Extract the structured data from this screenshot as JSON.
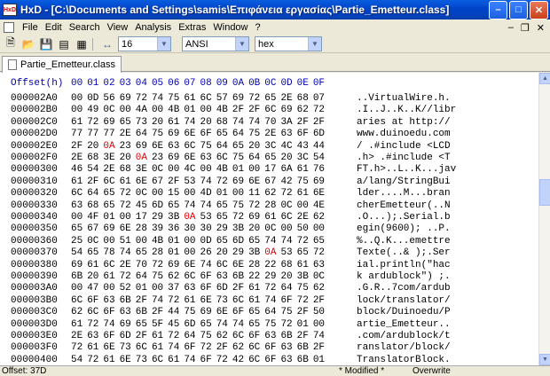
{
  "window": {
    "title": "HxD - [C:\\Documents and Settings\\samis\\Επιφάνεια εργασίας\\Partie_Emetteur.class]",
    "app_icon_text": "HxD"
  },
  "menu": [
    "File",
    "Edit",
    "Search",
    "View",
    "Analysis",
    "Extras",
    "Window",
    "?"
  ],
  "toolbar": {
    "bytes_per_row": "16",
    "charset": "ANSI",
    "offset_base": "hex"
  },
  "tab": {
    "label": "Partie_Emetteur.class"
  },
  "editor": {
    "offset_header": "Offset(h)",
    "column_headers": [
      "00",
      "01",
      "02",
      "03",
      "04",
      "05",
      "06",
      "07",
      "08",
      "09",
      "0A",
      "0B",
      "0C",
      "0D",
      "0E",
      "0F"
    ],
    "rows": [
      {
        "offset": "000002A0",
        "hex": [
          "00",
          "0D",
          "56",
          "69",
          "72",
          "74",
          "75",
          "61",
          "6C",
          "57",
          "69",
          "72",
          "65",
          "2E",
          "68",
          "07"
        ],
        "ascii": "..VirtualWire.h."
      },
      {
        "offset": "000002B0",
        "hex": [
          "00",
          "49",
          "0C",
          "00",
          "4A",
          "00",
          "4B",
          "01",
          "00",
          "4B",
          "2F",
          "2F",
          "6C",
          "69",
          "62",
          "72"
        ],
        "ascii": ".I..J..K..K//libr"
      },
      {
        "offset": "000002C0",
        "hex": [
          "61",
          "72",
          "69",
          "65",
          "73",
          "20",
          "61",
          "74",
          "20",
          "68",
          "74",
          "74",
          "70",
          "3A",
          "2F",
          "2F"
        ],
        "ascii": "aries at http://"
      },
      {
        "offset": "000002D0",
        "hex": [
          "77",
          "77",
          "77",
          "2E",
          "64",
          "75",
          "69",
          "6E",
          "6F",
          "65",
          "64",
          "75",
          "2E",
          "63",
          "6F",
          "6D"
        ],
        "ascii": "www.duinoedu.com"
      },
      {
        "offset": "000002E0",
        "hex": [
          "2F",
          "20",
          "0A",
          "23",
          "69",
          "6E",
          "63",
          "6C",
          "75",
          "64",
          "65",
          "20",
          "3C",
          "4C",
          "43",
          "44"
        ],
        "ascii": "/ .#include <LCD"
      },
      {
        "offset": "000002F0",
        "hex": [
          "2E",
          "68",
          "3E",
          "20",
          "0A",
          "23",
          "69",
          "6E",
          "63",
          "6C",
          "75",
          "64",
          "65",
          "20",
          "3C",
          "54"
        ],
        "ascii": ".h> .#include <T"
      },
      {
        "offset": "00000300",
        "hex": [
          "46",
          "54",
          "2E",
          "68",
          "3E",
          "0C",
          "00",
          "4C",
          "00",
          "4B",
          "01",
          "00",
          "17",
          "6A",
          "61",
          "76"
        ],
        "ascii": "FT.h>..L..K...jav"
      },
      {
        "offset": "00000310",
        "hex": [
          "61",
          "2F",
          "6C",
          "61",
          "6E",
          "67",
          "2F",
          "53",
          "74",
          "72",
          "69",
          "6E",
          "67",
          "42",
          "75",
          "69"
        ],
        "ascii": "a/lang/StringBui"
      },
      {
        "offset": "00000320",
        "hex": [
          "6C",
          "64",
          "65",
          "72",
          "0C",
          "00",
          "15",
          "00",
          "4D",
          "01",
          "00",
          "11",
          "62",
          "72",
          "61",
          "6E"
        ],
        "ascii": "lder....M...bran"
      },
      {
        "offset": "00000330",
        "hex": [
          "63",
          "68",
          "65",
          "72",
          "45",
          "6D",
          "65",
          "74",
          "74",
          "65",
          "75",
          "72",
          "28",
          "0C",
          "00",
          "4E"
        ],
        "ascii": "cherEmetteur(..N"
      },
      {
        "offset": "00000340",
        "hex": [
          "00",
          "4F",
          "01",
          "00",
          "17",
          "29",
          "3B",
          "0A",
          "53",
          "65",
          "72",
          "69",
          "61",
          "6C",
          "2E",
          "62"
        ],
        "ascii": ".O...);.Serial.b"
      },
      {
        "offset": "00000350",
        "hex": [
          "65",
          "67",
          "69",
          "6E",
          "28",
          "39",
          "36",
          "30",
          "30",
          "29",
          "3B",
          "20",
          "0C",
          "00",
          "50",
          "00"
        ],
        "ascii": "egin(9600); ..P."
      },
      {
        "offset": "00000360",
        "hex": [
          "25",
          "0C",
          "00",
          "51",
          "00",
          "4B",
          "01",
          "00",
          "0D",
          "65",
          "6D",
          "65",
          "74",
          "74",
          "72",
          "65"
        ],
        "ascii": "%..Q.K...emettre"
      },
      {
        "offset": "00000370",
        "hex": [
          "54",
          "65",
          "78",
          "74",
          "65",
          "28",
          "01",
          "00",
          "26",
          "20",
          "29",
          "3B",
          "0A",
          "53",
          "65",
          "72"
        ],
        "ascii": "Texte(..& );.Ser"
      },
      {
        "offset": "00000380",
        "hex": [
          "69",
          "61",
          "6C",
          "2E",
          "70",
          "72",
          "69",
          "6E",
          "74",
          "6C",
          "6E",
          "28",
          "22",
          "68",
          "61",
          "63"
        ],
        "ascii": "ial.println(\"hac"
      },
      {
        "offset": "00000390",
        "hex": [
          "6B",
          "20",
          "61",
          "72",
          "64",
          "75",
          "62",
          "6C",
          "6F",
          "63",
          "6B",
          "22",
          "29",
          "20",
          "3B",
          "0C"
        ],
        "ascii": "k ardublock\") ;."
      },
      {
        "offset": "000003A0",
        "hex": [
          "00",
          "47",
          "00",
          "52",
          "01",
          "00",
          "37",
          "63",
          "6F",
          "6D",
          "2F",
          "61",
          "72",
          "64",
          "75",
          "62"
        ],
        "ascii": ".G.R..7com/ardub"
      },
      {
        "offset": "000003B0",
        "hex": [
          "6C",
          "6F",
          "63",
          "6B",
          "2F",
          "74",
          "72",
          "61",
          "6E",
          "73",
          "6C",
          "61",
          "74",
          "6F",
          "72",
          "2F"
        ],
        "ascii": "lock/translator/"
      },
      {
        "offset": "000003C0",
        "hex": [
          "62",
          "6C",
          "6F",
          "63",
          "6B",
          "2F",
          "44",
          "75",
          "69",
          "6E",
          "6F",
          "65",
          "64",
          "75",
          "2F",
          "50"
        ],
        "ascii": "block/Duinoedu/P"
      },
      {
        "offset": "000003D0",
        "hex": [
          "61",
          "72",
          "74",
          "69",
          "65",
          "5F",
          "45",
          "6D",
          "65",
          "74",
          "74",
          "65",
          "75",
          "72",
          "01",
          "00"
        ],
        "ascii": "artie_Emetteur.."
      },
      {
        "offset": "000003E0",
        "hex": [
          "2E",
          "63",
          "6F",
          "6D",
          "2F",
          "61",
          "72",
          "64",
          "75",
          "62",
          "6C",
          "6F",
          "63",
          "6B",
          "2F",
          "74"
        ],
        "ascii": ".com/ardublock/t"
      },
      {
        "offset": "000003F0",
        "hex": [
          "72",
          "61",
          "6E",
          "73",
          "6C",
          "61",
          "74",
          "6F",
          "72",
          "2F",
          "62",
          "6C",
          "6F",
          "63",
          "6B",
          "2F"
        ],
        "ascii": "ranslator/block/"
      },
      {
        "offset": "00000400",
        "hex": [
          "54",
          "72",
          "61",
          "6E",
          "73",
          "6C",
          "61",
          "74",
          "6F",
          "72",
          "42",
          "6C",
          "6F",
          "63",
          "6B",
          "01"
        ],
        "ascii": "TranslatorBlock."
      }
    ],
    "highlighted_bytes": [
      "0A"
    ]
  },
  "status": {
    "offset": "Offset: 37D",
    "modified": "* Modified *",
    "mode": "Overwrite"
  }
}
